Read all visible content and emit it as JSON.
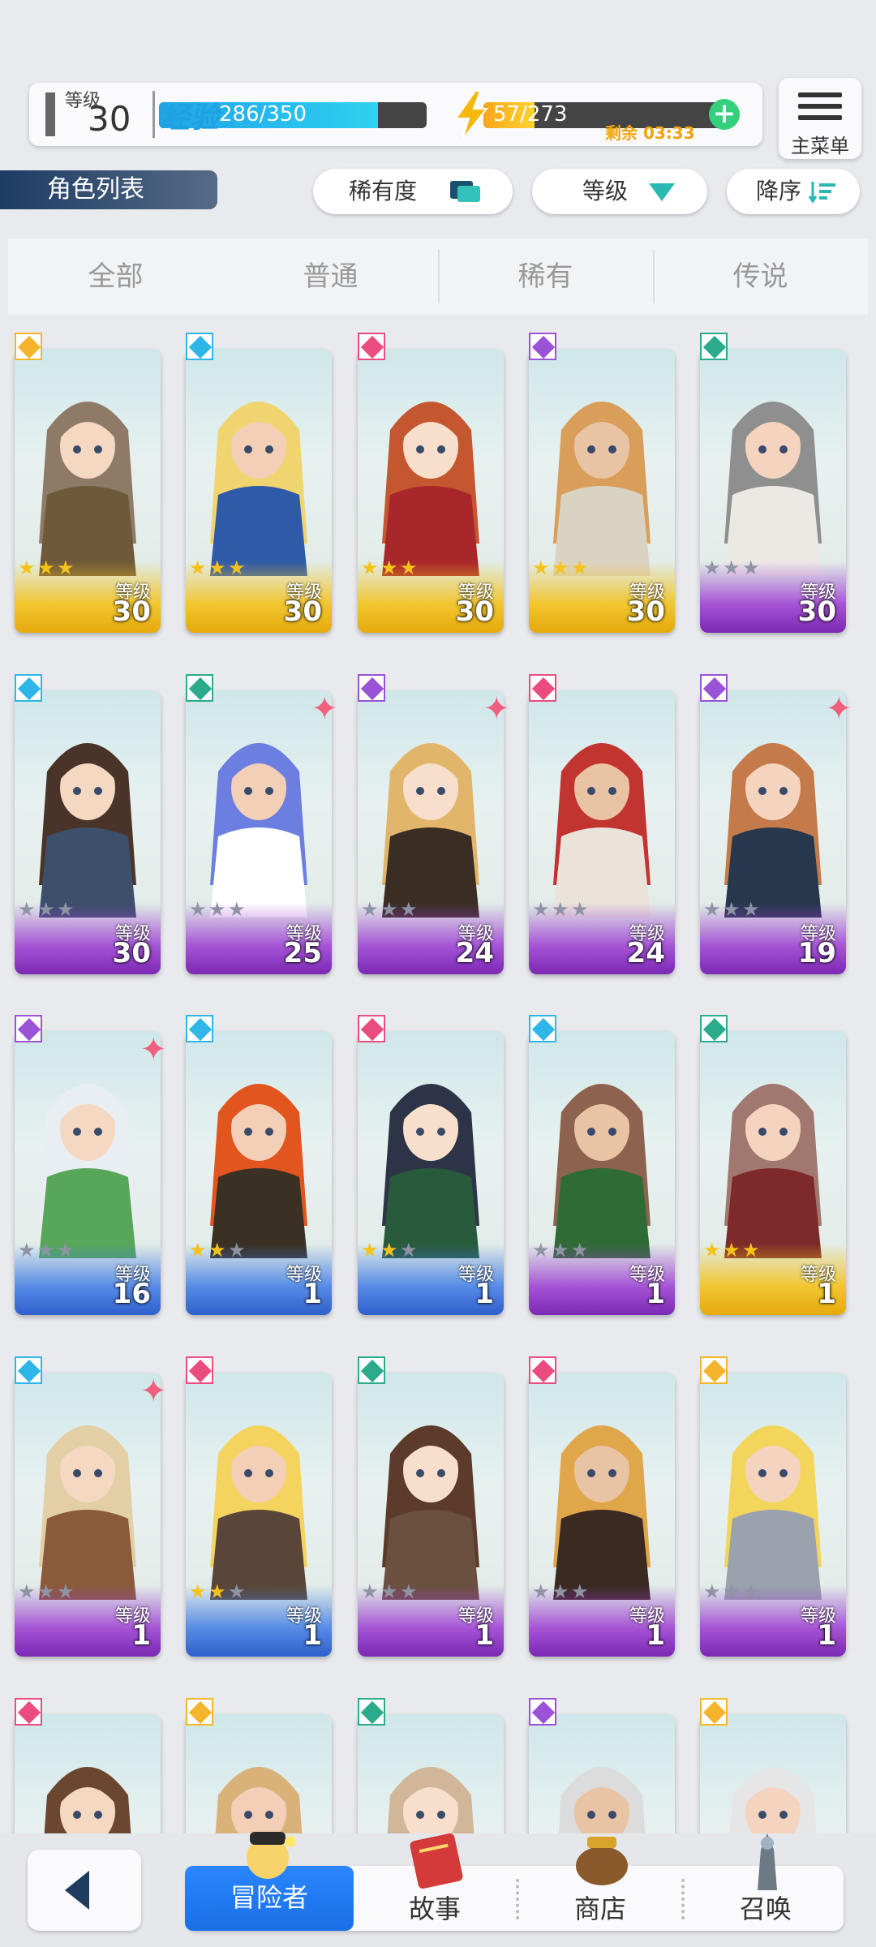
{
  "hud": {
    "level_label": "等级",
    "level_value": "30",
    "exp_label": "经验",
    "exp_value": "286/350",
    "exp_fraction": 0.817,
    "stamina_value": "57/273",
    "stamina_fraction": 0.21,
    "stamina_timer": "剩余 03:33",
    "add_symbol": "+"
  },
  "menu": {
    "label": "主菜单"
  },
  "list_title": "角色列表",
  "sort": {
    "rarity": "稀有度",
    "level": "等级",
    "order": "降序"
  },
  "tabs": [
    "全部",
    "普通",
    "稀有",
    "传说"
  ],
  "active_tab": 0,
  "level_label": "等级",
  "characters": [
    {
      "element": "yellow",
      "rarity": "gold",
      "stars": 3,
      "level": "30",
      "new": false
    },
    {
      "element": "blue",
      "rarity": "gold",
      "stars": 3,
      "level": "30",
      "new": false
    },
    {
      "element": "pink",
      "rarity": "gold",
      "stars": 3,
      "level": "30",
      "new": false
    },
    {
      "element": "purple",
      "rarity": "gold",
      "stars": 3,
      "level": "30",
      "new": false
    },
    {
      "element": "green",
      "rarity": "purple",
      "stars": 0,
      "level": "30",
      "new": false
    },
    {
      "element": "blue",
      "rarity": "purple",
      "stars": 0,
      "level": "30",
      "new": false
    },
    {
      "element": "green",
      "rarity": "purple",
      "stars": 0,
      "level": "25",
      "new": true
    },
    {
      "element": "purple",
      "rarity": "purple",
      "stars": 0,
      "level": "24",
      "new": true
    },
    {
      "element": "pink",
      "rarity": "purple",
      "stars": 0,
      "level": "24",
      "new": false
    },
    {
      "element": "purple",
      "rarity": "purple",
      "stars": 0,
      "level": "19",
      "new": true
    },
    {
      "element": "purple",
      "rarity": "blue",
      "stars": 0,
      "level": "16",
      "new": true
    },
    {
      "element": "blue",
      "rarity": "blue",
      "stars": 2,
      "level": "1",
      "new": false
    },
    {
      "element": "pink",
      "rarity": "blue",
      "stars": 2,
      "level": "1",
      "new": false
    },
    {
      "element": "blue",
      "rarity": "purple",
      "stars": 0,
      "level": "1",
      "new": false
    },
    {
      "element": "green",
      "rarity": "gold",
      "stars": 3,
      "level": "1",
      "new": false
    },
    {
      "element": "blue",
      "rarity": "purple",
      "stars": 0,
      "level": "1",
      "new": true
    },
    {
      "element": "pink",
      "rarity": "blue",
      "stars": 2,
      "level": "1",
      "new": false
    },
    {
      "element": "green",
      "rarity": "purple",
      "stars": 0,
      "level": "1",
      "new": false
    },
    {
      "element": "pink",
      "rarity": "purple",
      "stars": 0,
      "level": "1",
      "new": false
    },
    {
      "element": "yellow",
      "rarity": "purple",
      "stars": 0,
      "level": "1",
      "new": false
    },
    {
      "element": "pink",
      "rarity": "none",
      "stars": 0,
      "level": "",
      "new": false
    },
    {
      "element": "yellow",
      "rarity": "none",
      "stars": 0,
      "level": "",
      "new": false
    },
    {
      "element": "green",
      "rarity": "none",
      "stars": 0,
      "level": "",
      "new": false
    },
    {
      "element": "purple",
      "rarity": "none",
      "stars": 0,
      "level": "",
      "new": false
    },
    {
      "element": "yellow",
      "rarity": "none",
      "stars": 0,
      "level": "",
      "new": false
    }
  ],
  "colors": {
    "yellow": "#f4b52c",
    "blue": "#2fb6e8",
    "pink": "#ea4c7f",
    "purple": "#9a52d6",
    "green": "#2cab8c",
    "gold_bar": "#f4c21c",
    "purple_bar": "#9b3ad3",
    "blue_bar": "#3f7be6"
  },
  "nav": {
    "items": [
      "冒险者",
      "故事",
      "商店",
      "召唤"
    ],
    "active": 0
  }
}
